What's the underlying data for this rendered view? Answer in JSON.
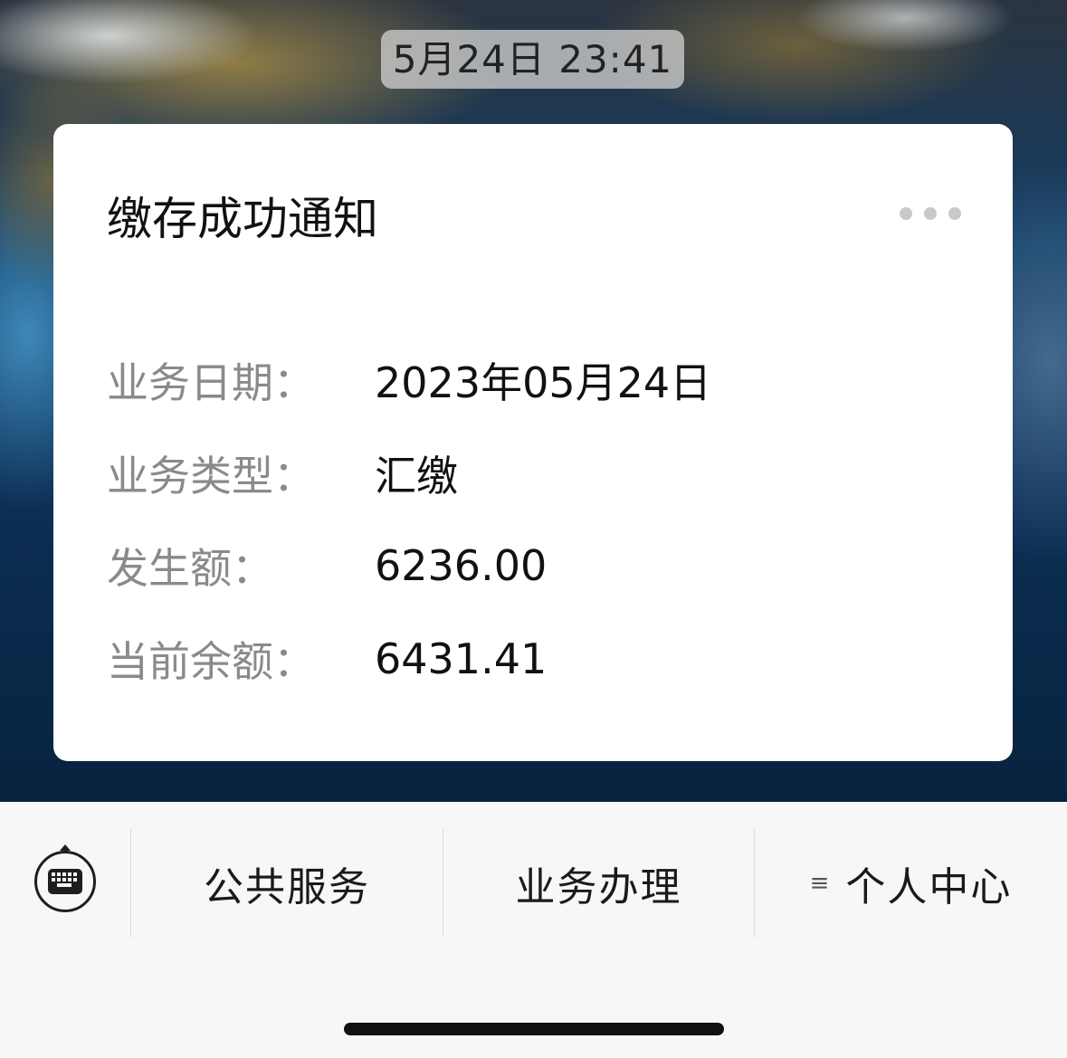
{
  "timestamp": "5月24日 23:41",
  "card": {
    "title": "缴存成功通知",
    "more_icon": "more-dots-icon",
    "rows": [
      {
        "label": "业务日期：",
        "value": "2023年05月24日"
      },
      {
        "label": "业务类型：",
        "value": "汇缴"
      },
      {
        "label": "发生额：",
        "value": "6236.00"
      },
      {
        "label": "当前余额：",
        "value": "6431.41"
      }
    ]
  },
  "menu": {
    "keyboard_icon": "keyboard-icon",
    "items": [
      {
        "label": "公共服务"
      },
      {
        "label": "业务办理"
      },
      {
        "label": "个人中心",
        "icon": "submenu-icon",
        "icon_glyph": "≡"
      }
    ]
  },
  "colors": {
    "card_background": "#ffffff",
    "label_gray": "#8a8a8a",
    "value_text": "#111111",
    "menu_background": "#f7f7f7",
    "divider": "#dcdcdc"
  }
}
